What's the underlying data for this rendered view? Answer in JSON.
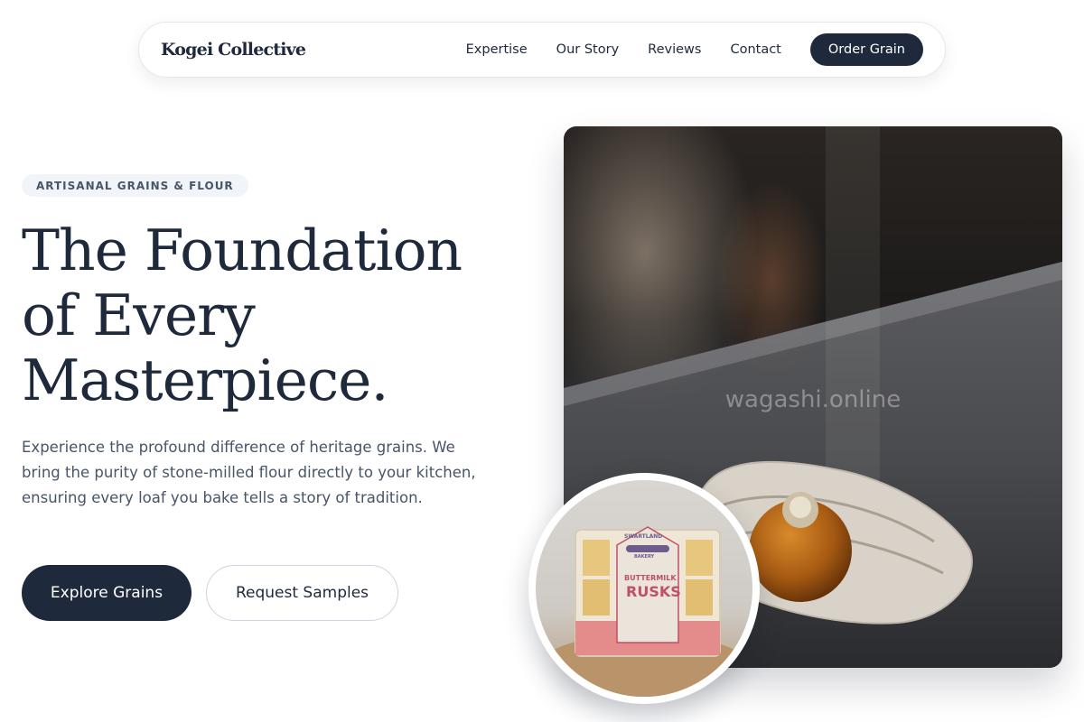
{
  "nav": {
    "brand": "Kogei Collective",
    "links": [
      {
        "label": "Expertise"
      },
      {
        "label": "Our Story"
      },
      {
        "label": "Reviews"
      },
      {
        "label": "Contact"
      }
    ],
    "cta": "Order Grain"
  },
  "hero": {
    "badge": "ARTISANAL GRAINS & FLOUR",
    "headline": [
      "The Foundation",
      "of Every",
      "Masterpiece."
    ],
    "lead": "Experience the profound difference of heritage grains. We bring the purity of stone-milled flour directly to your kitchen, ensuring every loaf you bake tells a story of tradition.",
    "primary_button": "Explore Grains",
    "secondary_button": "Request Samples"
  },
  "media": {
    "main_image_watermark": "wagashi.online",
    "inset_package": {
      "brand": "SWARTLAND",
      "brand_sub": "BAKERY",
      "product_line1": "BUTTERMILK",
      "product_line2": "RUSKS"
    }
  },
  "colors": {
    "primary": "#1e293b",
    "muted_text": "#475569",
    "badge_bg": "#f1f5f9"
  }
}
